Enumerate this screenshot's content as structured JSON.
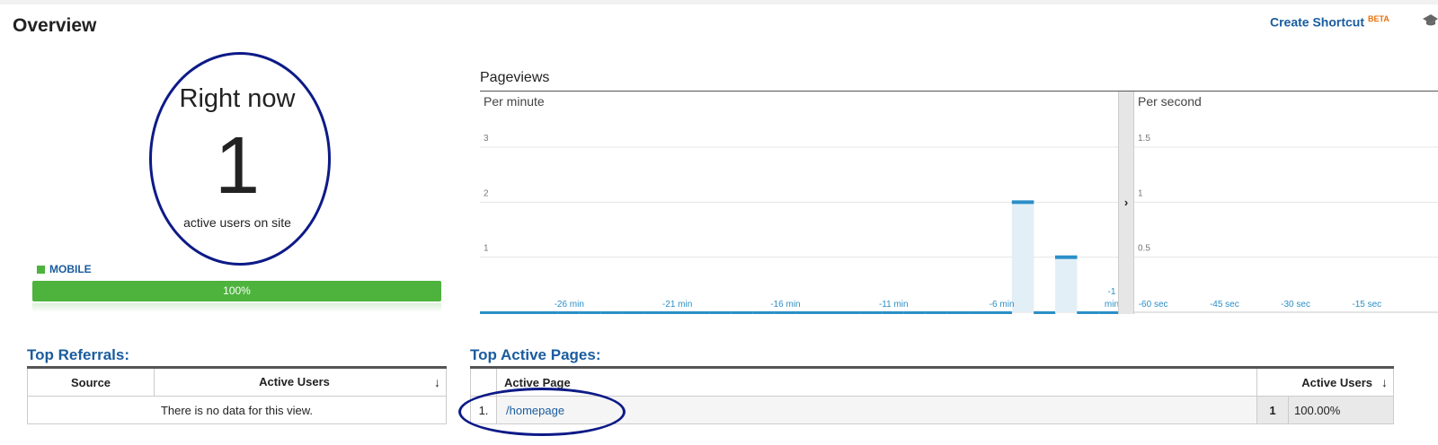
{
  "header": {
    "title": "Overview",
    "shortcut_label": "Create Shortcut",
    "beta_label": "BETA"
  },
  "right_now": {
    "title": "Right now",
    "count": "1",
    "subtitle": "active users on site",
    "device_label": "MOBILE",
    "device_percent_label": "100%",
    "device_share": 1.0,
    "device_color": "#4db33d"
  },
  "pageviews": {
    "title": "Pageviews",
    "expand_icon": "chevron-right-icon"
  },
  "chart_data": [
    {
      "type": "bar",
      "title": "Per minute",
      "x": [
        -30,
        -29,
        -28,
        -27,
        -26,
        -25,
        -24,
        -23,
        -22,
        -21,
        -20,
        -19,
        -18,
        -17,
        -16,
        -15,
        -14,
        -13,
        -12,
        -11,
        -10,
        -9,
        -8,
        -7,
        -6,
        -5,
        -4,
        -3,
        -2,
        -1
      ],
      "values": [
        0,
        0,
        0,
        0,
        0,
        0,
        0,
        0,
        0,
        0,
        0,
        0,
        0,
        0,
        0,
        0,
        0,
        0,
        0,
        0,
        0,
        0,
        0,
        0,
        0,
        2,
        0,
        1,
        0,
        0
      ],
      "xticks": [
        {
          "x": -26,
          "label": "-26 min"
        },
        {
          "x": -21,
          "label": "-21 min"
        },
        {
          "x": -16,
          "label": "-16 min"
        },
        {
          "x": -11,
          "label": "-11 min"
        },
        {
          "x": -6,
          "label": "-6 min"
        },
        {
          "x": -1,
          "label": "-1 min"
        }
      ],
      "yticks": [
        "1",
        "2",
        "3"
      ],
      "ylim": [
        0,
        3
      ],
      "grid": true,
      "color": "#2a8fc6"
    },
    {
      "type": "bar",
      "title": "Per second",
      "xticks": [
        {
          "x": -60,
          "label": "-60 sec"
        },
        {
          "x": -45,
          "label": "-45 sec"
        },
        {
          "x": -30,
          "label": "-30 sec"
        },
        {
          "x": -15,
          "label": "-15 sec"
        }
      ],
      "values": [],
      "yticks": [
        "0.5",
        "1",
        "1.5"
      ],
      "ylim": [
        0,
        1.5
      ],
      "grid": true,
      "color": "#2a8fc6"
    }
  ],
  "referrals": {
    "title": "Top Referrals:",
    "columns": [
      "Source",
      "Active Users"
    ],
    "empty_message": "There is no data for this view."
  },
  "active_pages": {
    "title": "Top Active Pages:",
    "columns": [
      "Active Page",
      "Active Users"
    ],
    "rows": [
      {
        "index": "1.",
        "page": "/homepage",
        "users": "1",
        "percent": "100.00%"
      }
    ]
  },
  "colors": {
    "link": "#1a5c9e",
    "accent": "#2a8fc6",
    "mobile": "#4db33d",
    "annotation": "#0d1a87"
  }
}
